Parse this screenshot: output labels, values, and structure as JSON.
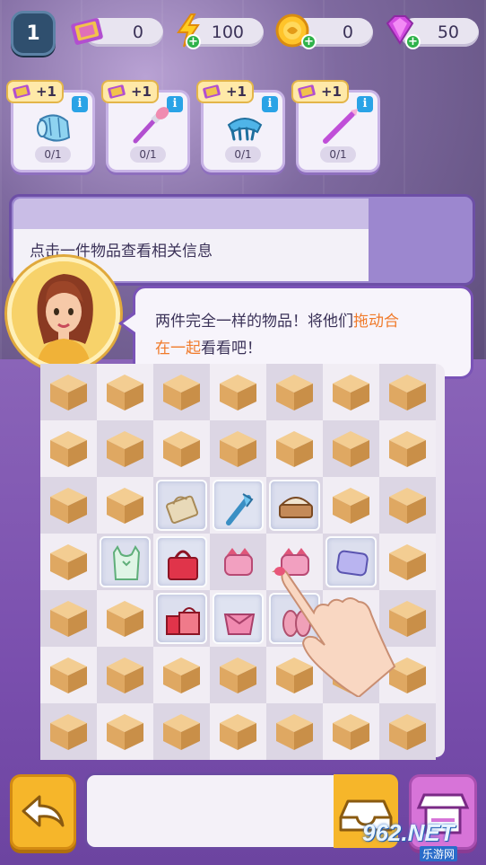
{
  "hud": {
    "level": "1",
    "tickets": "0",
    "energy": "100",
    "coins": "0",
    "gems": "50"
  },
  "orders": [
    {
      "reward": "+1",
      "progress": "0/1",
      "item": "hair-curler-icon"
    },
    {
      "reward": "+1",
      "progress": "0/1",
      "item": "makeup-brush-icon"
    },
    {
      "reward": "+1",
      "progress": "0/1",
      "item": "hair-clip-icon"
    },
    {
      "reward": "+1",
      "progress": "0/1",
      "item": "eyebrow-pencil-icon"
    }
  ],
  "info_panel": {
    "text": "点击一件物品查看相关信息"
  },
  "tutorial": {
    "line1_a": "两件完全一样的物品！将他们",
    "line1_b": "拖动合",
    "line2_a": "在一起",
    "line2_b": "看看吧！"
  },
  "watermark": {
    "big": "962.NET",
    "small": "乐游网"
  },
  "colors": {
    "accent_purple": "#7a53b7",
    "highlight_orange": "#f07a2a",
    "button_yellow": "#f6b62a",
    "shop_pink": "#d774d8"
  }
}
